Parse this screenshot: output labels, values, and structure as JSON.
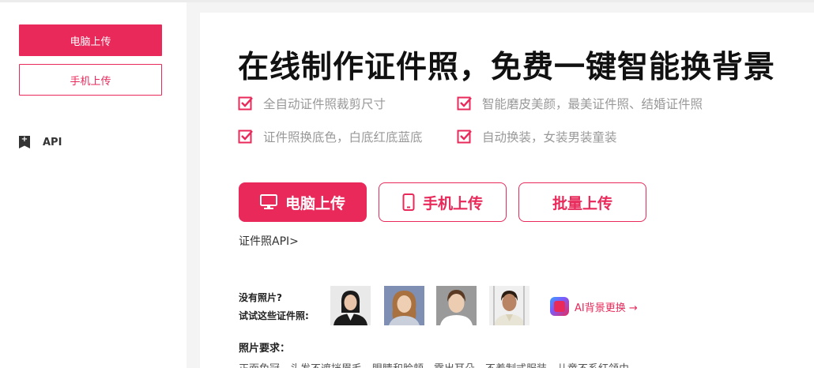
{
  "sidebar": {
    "pc_upload": "电脑上传",
    "mobile_upload": "手机上传",
    "api": "API"
  },
  "main": {
    "title": "在线制作证件照，免费一键智能换背景",
    "features": [
      "全自动证件照裁剪尺寸",
      "智能磨皮美颜，最美证件照、结婚证件照",
      "证件照换底色，白底红底蓝底",
      "自动换装，女装男装童装"
    ],
    "buttons": {
      "pc": "电脑上传",
      "mobile": "手机上传",
      "batch": "批量上传"
    },
    "api_link": "证件照API>",
    "samples": {
      "line1": "没有照片?",
      "line2": "试试这些证件照:"
    },
    "ai_link": "AI背景更换 →",
    "requirements": {
      "title": "照片要求：",
      "text": "正面免冠，头发不遮挡眉毛，眼睛和脸颊，露出耳朵，不着制式服装，儿童不系红领巾"
    }
  },
  "colors": {
    "accent": "#e8295a",
    "background": "#f4f4f4"
  },
  "icons": {
    "check": "check-icon",
    "monitor": "monitor-icon",
    "phone": "phone-icon",
    "flag": "flag-icon"
  }
}
